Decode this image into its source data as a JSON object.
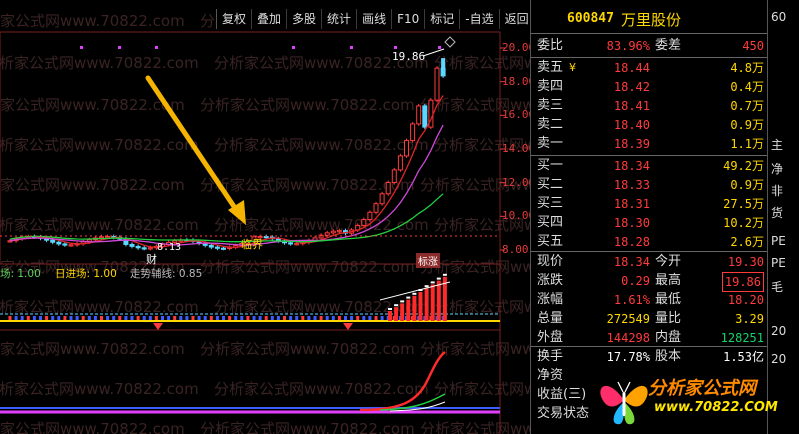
{
  "toolbar": [
    "复权",
    "叠加",
    "多股",
    "统计",
    "画线",
    "F10",
    "标记",
    "-自选",
    "返回"
  ],
  "watermark_text": "分析家公式网www.70822.com",
  "price_axis": [
    "20.00",
    "18.00",
    "16.00",
    "14.00",
    "12.00",
    "10.00",
    "8.00"
  ],
  "price_axis_values": [
    20,
    18,
    16,
    14,
    12,
    10,
    8
  ],
  "high_label": "19.86",
  "low_label": "8.13",
  "markers": {
    "cai": "财",
    "linjie": "临界",
    "biaozhang": "标涨"
  },
  "indicator": {
    "a_label": "场: 1.00",
    "b_label": "日进场: 1.00",
    "c_label": "走势辅线: 0.85"
  },
  "quote": {
    "code": "600847",
    "name": "万里股份",
    "weibi_label": "委比",
    "weibi_value": "83.96%",
    "weicha_label": "委差",
    "weicha_value": "450",
    "asks": [
      {
        "label": "卖五",
        "mark": "¥",
        "price": "18.44",
        "vol": "4.8万"
      },
      {
        "label": "卖四",
        "mark": "",
        "price": "18.42",
        "vol": "0.4万"
      },
      {
        "label": "卖三",
        "mark": "",
        "price": "18.41",
        "vol": "0.7万"
      },
      {
        "label": "卖二",
        "mark": "",
        "price": "18.40",
        "vol": "0.9万"
      },
      {
        "label": "卖一",
        "mark": "",
        "price": "18.39",
        "vol": "1.1万"
      }
    ],
    "bids": [
      {
        "label": "买一",
        "price": "18.34",
        "vol": "49.2万"
      },
      {
        "label": "买二",
        "price": "18.33",
        "vol": "0.9万"
      },
      {
        "label": "买三",
        "price": "18.31",
        "vol": "27.5万"
      },
      {
        "label": "买四",
        "price": "18.30",
        "vol": "10.2万"
      },
      {
        "label": "买五",
        "price": "18.28",
        "vol": "2.6万"
      }
    ],
    "stats": [
      {
        "l1": "现价",
        "v1": "18.34",
        "c1": "red",
        "l2": "今开",
        "v2": "19.30",
        "c2": "red"
      },
      {
        "l1": "涨跌",
        "v1": "0.29",
        "c1": "red",
        "l2": "最高",
        "v2": "19.86",
        "c2": "red"
      },
      {
        "l1": "涨幅",
        "v1": "1.61%",
        "c1": "red",
        "l2": "最低",
        "v2": "18.20",
        "c2": "red"
      },
      {
        "l1": "总量",
        "v1": "272549",
        "c1": "yellow",
        "l2": "量比",
        "v2": "3.29",
        "c2": "yellow"
      },
      {
        "l1": "外盘",
        "v1": "144298",
        "c1": "red",
        "l2": "内盘",
        "v2": "128251",
        "c2": "green"
      }
    ],
    "extra": [
      {
        "l1": "换手",
        "v1": "17.78%",
        "l2": "股本",
        "v2": "1.53亿"
      },
      {
        "l1": "净资",
        "v1": "",
        "l2": "",
        "v2": ""
      },
      {
        "l1": "收益(三)",
        "v1": "",
        "l2": "",
        "v2": ""
      },
      {
        "l1": "交易状态",
        "v1": "",
        "l2": "",
        "v2": ""
      }
    ]
  },
  "strip": [
    "60",
    "主",
    "净",
    "非",
    "货",
    "PE",
    "PE",
    "毛",
    "20",
    "20"
  ],
  "logo": {
    "title": "分析家公式网",
    "url": "www.70822.COM"
  },
  "colors": {
    "up": "#ff3b3b",
    "down": "#14d36a",
    "ma_red": "#e0242a",
    "ma_magenta": "#d048d8",
    "ma_green": "#22d040",
    "accent": "#ffd700"
  }
}
